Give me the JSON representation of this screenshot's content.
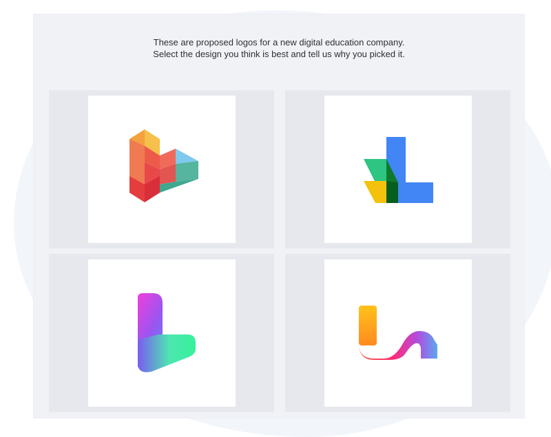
{
  "instructions": {
    "line1": "These are proposed logos for a new digital education company.",
    "line2": "Select the design you think is best and tell us why you picked it."
  },
  "options": [
    {
      "icon": "geometric-b-play-logo-icon"
    },
    {
      "icon": "layered-l-logo-icon"
    },
    {
      "icon": "gradient-l-logo-icon"
    },
    {
      "icon": "ribbon-wave-logo-icon"
    }
  ],
  "colors": {
    "panel": "#f1f2f5",
    "cell": "#e6e8ed",
    "card": "#ffffff",
    "text": "#2b2f36"
  }
}
